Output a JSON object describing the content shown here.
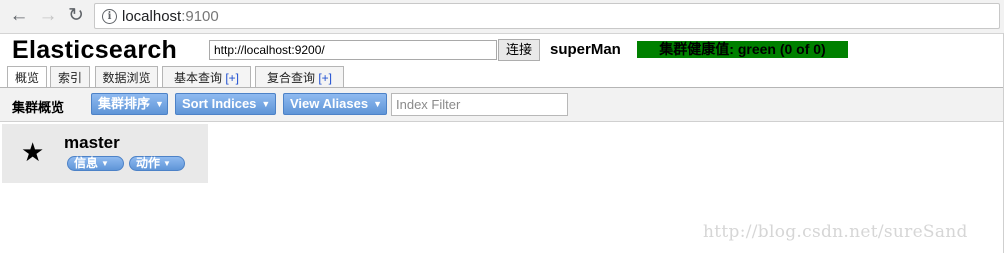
{
  "browser": {
    "back_icon": "arrow-left-icon",
    "forward_icon": "arrow-right-icon",
    "reload_icon": "reload-icon",
    "info_icon": "info-icon",
    "url_host": "localhost",
    "url_port": ":9100"
  },
  "header": {
    "title": "Elasticsearch",
    "cluster_url_value": "http://localhost:9200/",
    "connect_label": "连接",
    "cluster_name": "superMan",
    "health_text": "集群健康值: green (0 of 0)",
    "health_color": "#008000"
  },
  "tabs": [
    {
      "label": "概览",
      "plus": ""
    },
    {
      "label": "索引",
      "plus": ""
    },
    {
      "label": "数据浏览",
      "plus": ""
    },
    {
      "label": "基本查询 ",
      "plus": "[+]"
    },
    {
      "label": "复合查询 ",
      "plus": "[+]"
    }
  ],
  "toolbar": {
    "title": "集群概览",
    "sort_cluster_label": "集群排序",
    "sort_indices_label": "Sort Indices",
    "view_aliases_label": "View Aliases",
    "index_filter_placeholder": "Index Filter",
    "button_color": "#6a9fe0"
  },
  "node": {
    "icon": "star-icon",
    "name": "master",
    "info_label": "信息",
    "actions_label": "动作"
  },
  "watermark": "http://blog.csdn.net/sureSand"
}
